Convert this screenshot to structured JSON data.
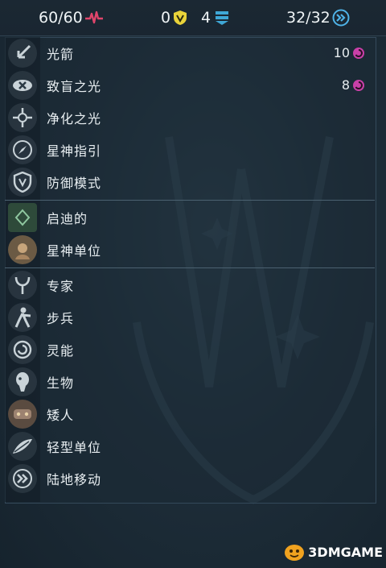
{
  "topbar": {
    "health": "60/60",
    "shield": "0",
    "armor": "4",
    "movement": "32/32"
  },
  "colors": {
    "health": "#e0456b",
    "shield": "#e9d33a",
    "armor": "#3fa7d6",
    "movement": "#4fb3e8",
    "psionic": "#c940a8"
  },
  "abilities": [
    {
      "label": "光箭",
      "icon": "arrow-icon",
      "cost": "10"
    },
    {
      "label": "致盲之光",
      "icon": "eye-icon",
      "cost": "8"
    },
    {
      "label": "净化之光",
      "icon": "purify-icon"
    },
    {
      "label": "星神指引",
      "icon": "compass-icon"
    },
    {
      "label": "防御模式",
      "icon": "shield-icon"
    }
  ],
  "factions": [
    {
      "label": "启迪的",
      "icon": "enlightened-icon"
    },
    {
      "label": "星神单位",
      "icon": "celestial-icon"
    }
  ],
  "traits": [
    {
      "label": "专家",
      "icon": "specialist-icon"
    },
    {
      "label": "步兵",
      "icon": "infantry-icon"
    },
    {
      "label": "灵能",
      "icon": "psychic-icon"
    },
    {
      "label": "生物",
      "icon": "biological-icon"
    },
    {
      "label": "矮人",
      "icon": "dwarf-icon"
    },
    {
      "label": "轻型单位",
      "icon": "light-unit-icon"
    },
    {
      "label": "陆地移动",
      "icon": "land-move-icon"
    }
  ],
  "watermark": "3DMGAME"
}
